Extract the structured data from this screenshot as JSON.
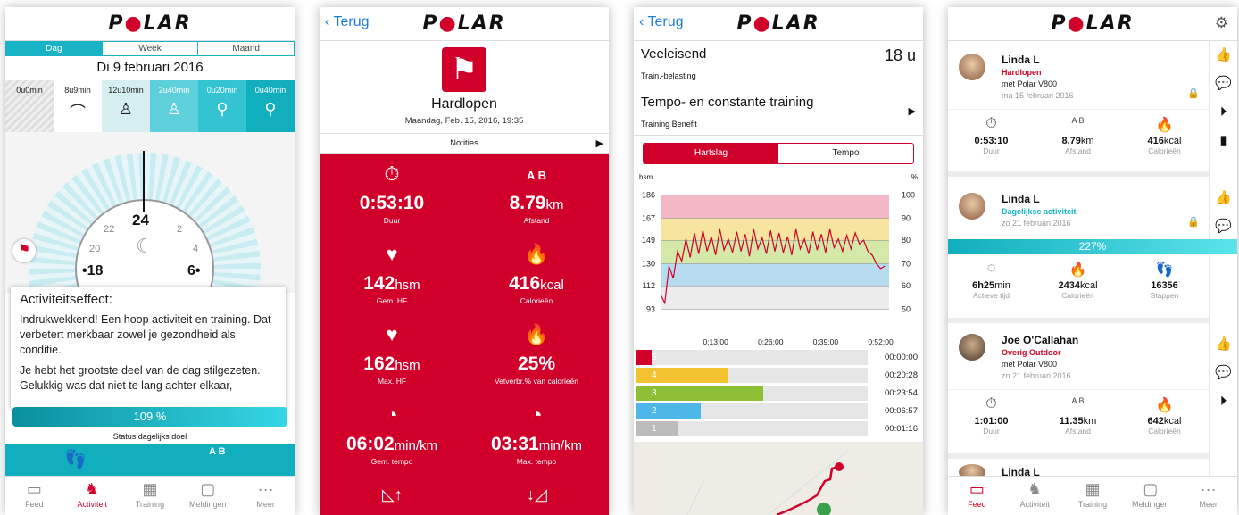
{
  "logo": "POLAR",
  "s1": {
    "tabs": [
      "Dag",
      "Week",
      "Maand"
    ],
    "date": "Di 9 februari 2016",
    "levels": [
      {
        "h": "0",
        "m": "0",
        "hu": "u",
        "mu": "min",
        "icon": "▨"
      },
      {
        "h": "8",
        "m": "9",
        "hu": "u",
        "mu": "min",
        "icon": "⌒"
      },
      {
        "h": "12",
        "m": "10",
        "hu": "u",
        "mu": "min",
        "icon": "♙"
      },
      {
        "h": "2",
        "m": "40",
        "hu": "u",
        "mu": "min",
        "icon": "♙"
      },
      {
        "h": "0",
        "m": "20",
        "hu": "u",
        "mu": "min",
        "icon": "⚲"
      },
      {
        "h": "0",
        "m": "40",
        "hu": "u",
        "mu": "min",
        "icon": "⚲"
      }
    ],
    "clock": {
      "t24": "24",
      "t22": "22",
      "t2": "2",
      "t20": "20",
      "t4": "4",
      "t18": "•18",
      "t6": "6•"
    },
    "modal_title": "Activiteitseffect:",
    "modal_p1": "Indrukwekkend! Een hoop activiteit en training. Dat verbetert merkbaar zowel je gezondheid als conditie.",
    "modal_p2": "Je hebt het grootste deel van de dag stilgezeten. Gelukkig was dat niet te lang achter elkaar,",
    "goal_pct": "109 %",
    "goal_label": "Status dagelijks doel",
    "tabbar": [
      "Feed",
      "Activiteit",
      "Training",
      "Meldingen",
      "Meer"
    ]
  },
  "s2": {
    "back": "Terug",
    "sport": "Hardlopen",
    "datetime": "Maandag, Feb. 15, 2016, 19:35",
    "notes": "Notities",
    "stats": [
      {
        "v": "0:53:10",
        "u": "",
        "l": "Duur",
        "i": "⏱"
      },
      {
        "v": "8.79",
        "u": "km",
        "l": "Afstand",
        "i": "A B"
      },
      {
        "v": "142",
        "u": "hsm",
        "l": "Gem. HF",
        "i": "♥"
      },
      {
        "v": "416",
        "u": "kcal",
        "l": "Calorieën",
        "i": "🔥"
      },
      {
        "v": "162",
        "u": "hsm",
        "l": "Max. HF",
        "i": "♥"
      },
      {
        "v": "25%",
        "u": "",
        "l": "Vetverbr.% van calorieën",
        "i": "🔥"
      },
      {
        "v": "06:02",
        "u": "min/km",
        "l": "Gem. tempo",
        "i": "◔"
      },
      {
        "v": "03:31",
        "u": "min/km",
        "l": "Max. tempo",
        "i": "◔"
      }
    ]
  },
  "s3": {
    "back": "Terug",
    "load_value": "Veeleisend",
    "load_hours": "18 u",
    "load_label": "Train.-belasting",
    "benefit_value": "Tempo- en constante training",
    "benefit_label": "Training Benefit",
    "tabs": [
      "Hartslag",
      "Tempo"
    ],
    "yleft_unit": "hsm",
    "yright_unit": "%",
    "zones": [
      {
        "z": "5",
        "t": "00:00:00",
        "frac": 0.04,
        "c": "#d0002a"
      },
      {
        "z": "4",
        "t": "00:20:28",
        "frac": 0.4,
        "c": "#f2c230"
      },
      {
        "z": "3",
        "t": "00:23:54",
        "frac": 0.55,
        "c": "#8cbf34"
      },
      {
        "z": "2",
        "t": "00:06:57",
        "frac": 0.28,
        "c": "#4db8e8"
      },
      {
        "z": "1",
        "t": "00:01:16",
        "frac": 0.18,
        "c": "#bcbcbc"
      }
    ]
  },
  "chart_data": {
    "type": "line",
    "yleft_ticks": [
      186,
      167,
      149,
      130,
      112,
      93
    ],
    "yright_ticks": [
      100,
      90,
      80,
      70,
      60,
      50
    ],
    "x_ticks": [
      "0:13:00",
      "0:26:00",
      "0:39:00",
      "0:52:00"
    ],
    "ylim": [
      86,
      192
    ],
    "xlim_min": [
      0,
      54
    ],
    "zone_bands": [
      {
        "from": 167,
        "to": 186,
        "color": "#f2b8c6"
      },
      {
        "from": 149,
        "to": 167,
        "color": "#f7e49e"
      },
      {
        "from": 130,
        "to": 149,
        "color": "#d4e8a8"
      },
      {
        "from": 112,
        "to": 130,
        "color": "#b8dcef"
      },
      {
        "from": 93,
        "to": 112,
        "color": "#ececec"
      }
    ],
    "series": [
      {
        "color": "#d0002a",
        "x": [
          0,
          1,
          2,
          3,
          4,
          5,
          6,
          7,
          8,
          9,
          10,
          11,
          12,
          13,
          14,
          15,
          16,
          17,
          18,
          19,
          20,
          21,
          22,
          23,
          24,
          25,
          26,
          27,
          28,
          29,
          30,
          31,
          32,
          33,
          34,
          35,
          36,
          37,
          38,
          39,
          40,
          41,
          42,
          43,
          44,
          45,
          46,
          47,
          48,
          49,
          50,
          51,
          52,
          53
        ],
        "y": [
          105,
          98,
          128,
          118,
          140,
          132,
          150,
          135,
          155,
          138,
          157,
          140,
          152,
          137,
          158,
          141,
          150,
          139,
          156,
          140,
          154,
          136,
          158,
          142,
          151,
          138,
          157,
          140,
          155,
          139,
          152,
          137,
          158,
          142,
          150,
          138,
          156,
          141,
          154,
          139,
          158,
          143,
          150,
          140,
          153,
          142,
          155,
          146,
          149,
          140,
          137,
          130,
          126,
          128
        ]
      }
    ]
  },
  "s4": {
    "cards": [
      {
        "name": "Linda L",
        "type": "Hardlopen",
        "type_color": "#d0002a",
        "sub": "met Polar V800",
        "date": "ma 15 februari 2016",
        "stats": [
          {
            "i": "⏱",
            "v": "0:53:10",
            "u": "",
            "l": "Duur"
          },
          {
            "i": "A B",
            "v": "8.79",
            "u": "km",
            "l": "Afstand"
          },
          {
            "i": "🔥",
            "v": "416",
            "u": "kcal",
            "l": "Calorieën"
          }
        ]
      },
      {
        "name": "Linda L",
        "type": "Dagelijkse activiteit",
        "type_color": "#18b3c4",
        "sub": "",
        "date": "zo 21 februari 2016",
        "bar": "227%",
        "stats": [
          {
            "i": "◌",
            "v": "6h25",
            "u": "min",
            "l": "Actieve tijd"
          },
          {
            "i": "🔥",
            "v": "2434",
            "u": "kcal",
            "l": "Calorieën"
          },
          {
            "i": "👣",
            "v": "16356",
            "u": "",
            "l": "Stappen"
          }
        ]
      },
      {
        "name": "Joe O'Callahan",
        "type": "Overig Outdoor",
        "type_color": "#d0002a",
        "sub": "met Polar V800",
        "date": "zo 21 februari 2016",
        "stats": [
          {
            "i": "⏱",
            "v": "1:01:00",
            "u": "",
            "l": "Duur"
          },
          {
            "i": "A B",
            "v": "11.35",
            "u": "km",
            "l": "Afstand"
          },
          {
            "i": "🔥",
            "v": "642",
            "u": "kcal",
            "l": "Calorieën"
          }
        ]
      },
      {
        "name": "Linda L"
      }
    ],
    "tabbar": [
      "Feed",
      "Activiteit",
      "Training",
      "Meldingen",
      "Meer"
    ]
  }
}
